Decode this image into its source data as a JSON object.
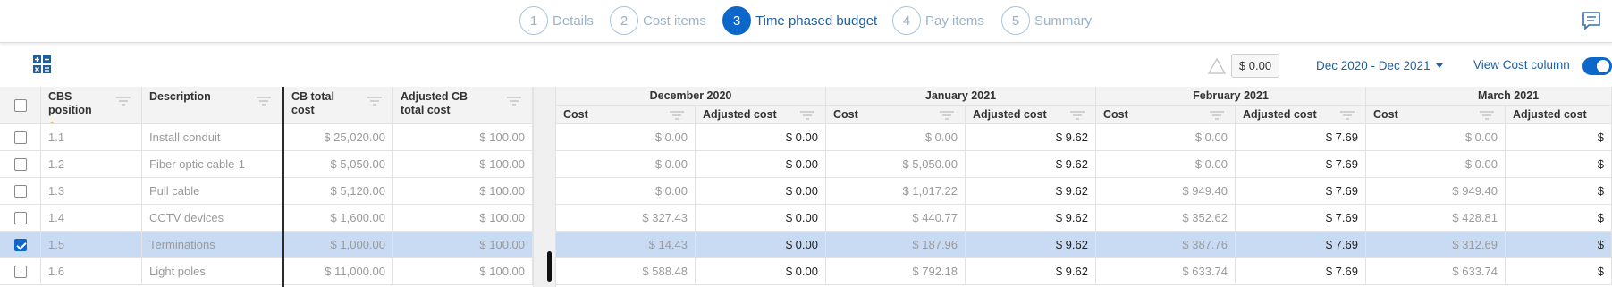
{
  "stepper": {
    "steps": [
      {
        "num": "1",
        "label": "Details",
        "active": false
      },
      {
        "num": "2",
        "label": "Cost items",
        "active": false
      },
      {
        "num": "3",
        "label": "Time phased budget",
        "active": true
      },
      {
        "num": "4",
        "label": "Pay items",
        "active": false
      },
      {
        "num": "5",
        "label": "Summary",
        "active": false
      }
    ]
  },
  "toolbar": {
    "total_value": "$ 0.00",
    "date_range": "Dec 2020 - Dec 2021",
    "view_cost_label": "View Cost column",
    "view_cost_enabled": true
  },
  "left_headers": {
    "cbs_position": "CBS position",
    "description": "Description",
    "cb_total_cost": "CB total cost",
    "adjusted_cb_total_cost": "Adjusted CB total cost"
  },
  "months": [
    "December 2020",
    "January 2021",
    "February 2021",
    "March 2021"
  ],
  "sub_headers": {
    "cost": "Cost",
    "adjusted_cost": "Adjusted cost"
  },
  "rows": [
    {
      "pos": "1.1",
      "desc": "Install conduit",
      "cb_total": "$ 25,020.00",
      "adj_cb_total": "$ 100.00",
      "checked": false,
      "months": [
        [
          "$ 0.00",
          "$ 0.00"
        ],
        [
          "$ 0.00",
          "$ 9.62"
        ],
        [
          "$ 0.00",
          "$ 7.69"
        ],
        [
          "$ 0.00",
          "$"
        ]
      ]
    },
    {
      "pos": "1.2",
      "desc": "Fiber optic cable-1",
      "cb_total": "$ 5,050.00",
      "adj_cb_total": "$ 100.00",
      "checked": false,
      "months": [
        [
          "$ 0.00",
          "$ 0.00"
        ],
        [
          "$ 5,050.00",
          "$ 9.62"
        ],
        [
          "$ 0.00",
          "$ 7.69"
        ],
        [
          "$ 0.00",
          "$"
        ]
      ]
    },
    {
      "pos": "1.3",
      "desc": "Pull cable",
      "cb_total": "$ 5,120.00",
      "adj_cb_total": "$ 100.00",
      "checked": false,
      "months": [
        [
          "$ 0.00",
          "$ 0.00"
        ],
        [
          "$ 1,017.22",
          "$ 9.62"
        ],
        [
          "$ 949.40",
          "$ 7.69"
        ],
        [
          "$ 949.40",
          "$"
        ]
      ]
    },
    {
      "pos": "1.4",
      "desc": "CCTV devices",
      "cb_total": "$ 1,600.00",
      "adj_cb_total": "$ 100.00",
      "checked": false,
      "months": [
        [
          "$ 327.43",
          "$ 0.00"
        ],
        [
          "$ 440.77",
          "$ 9.62"
        ],
        [
          "$ 352.62",
          "$ 7.69"
        ],
        [
          "$ 428.81",
          "$"
        ]
      ]
    },
    {
      "pos": "1.5",
      "desc": "Terminations",
      "cb_total": "$ 1,000.00",
      "adj_cb_total": "$ 100.00",
      "checked": true,
      "months": [
        [
          "$ 14.43",
          "$ 0.00"
        ],
        [
          "$ 187.96",
          "$ 9.62"
        ],
        [
          "$ 387.76",
          "$ 7.69"
        ],
        [
          "$ 312.69",
          "$"
        ]
      ]
    },
    {
      "pos": "1.6",
      "desc": "Light poles",
      "cb_total": "$ 11,000.00",
      "adj_cb_total": "$ 100.00",
      "checked": false,
      "months": [
        [
          "$ 588.48",
          "$ 0.00"
        ],
        [
          "$ 792.18",
          "$ 9.62"
        ],
        [
          "$ 633.74",
          "$ 7.69"
        ],
        [
          "$ 633.74",
          "$"
        ]
      ]
    }
  ]
}
